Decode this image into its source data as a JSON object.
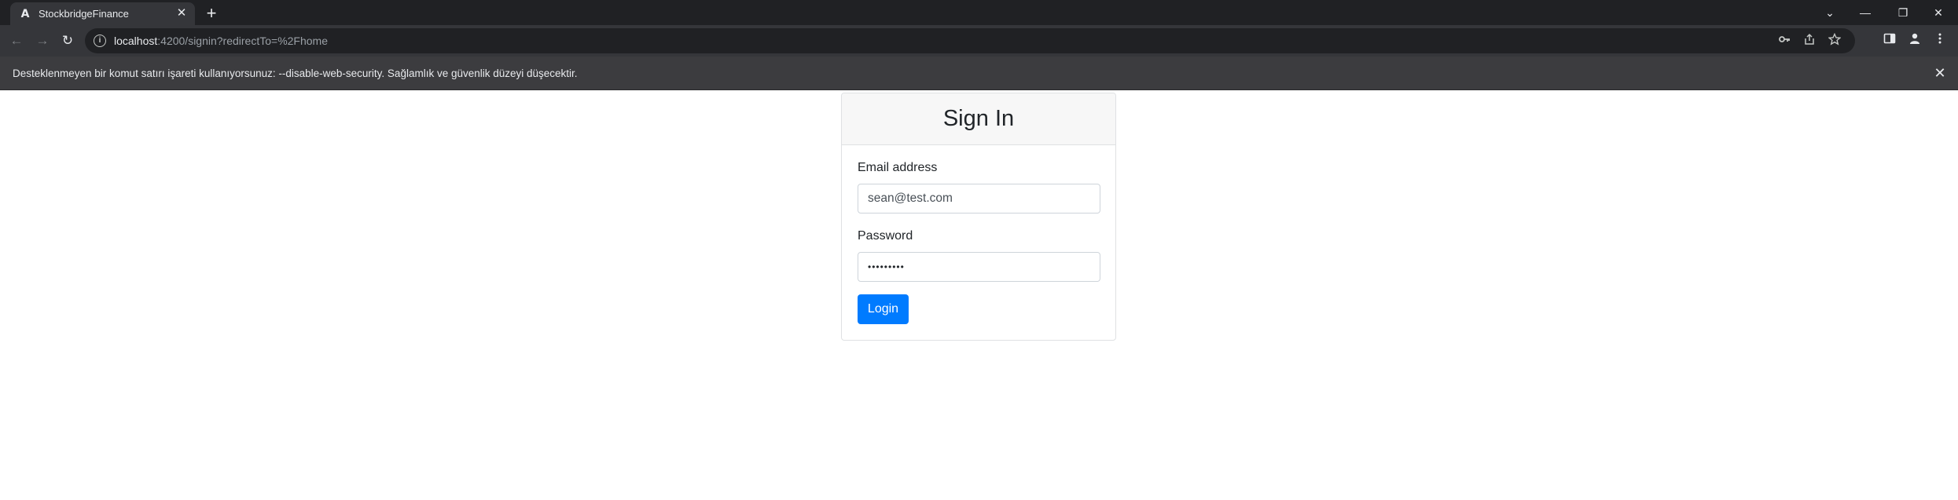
{
  "browser": {
    "tab": {
      "favicon": "A",
      "title": "StockbridgeFinance",
      "close": "✕"
    },
    "new_tab": "+",
    "window_controls": {
      "tab_search": "⌄",
      "minimize": "—",
      "restore": "❐",
      "close": "✕"
    },
    "nav": {
      "back": "←",
      "forward": "→",
      "reload": "↻"
    },
    "omnibox": {
      "info_icon": "i",
      "host": "localhost",
      "path": ":4200/signin?redirectTo=%2Fhome",
      "icons": [
        "key-icon",
        "share-icon",
        "star-icon"
      ]
    },
    "toolbar_icons": [
      "side-panel-icon",
      "profile-icon",
      "menu-icon"
    ]
  },
  "infobar": {
    "message": "Desteklenmeyen bir komut satırı işareti kullanıyorsunuz: --disable-web-security. Sağlamlık ve güvenlik düzeyi düşecektir.",
    "close": "✕"
  },
  "signin": {
    "title": "Sign In",
    "email_label": "Email address",
    "email_value": "sean@test.com",
    "password_label": "Password",
    "password_value": "•••••••••",
    "login_label": "Login"
  },
  "colors": {
    "primary_button": "#007bff",
    "tab_bar": "#202124",
    "toolbar": "#35363a",
    "infobar": "#3c3c3f"
  }
}
